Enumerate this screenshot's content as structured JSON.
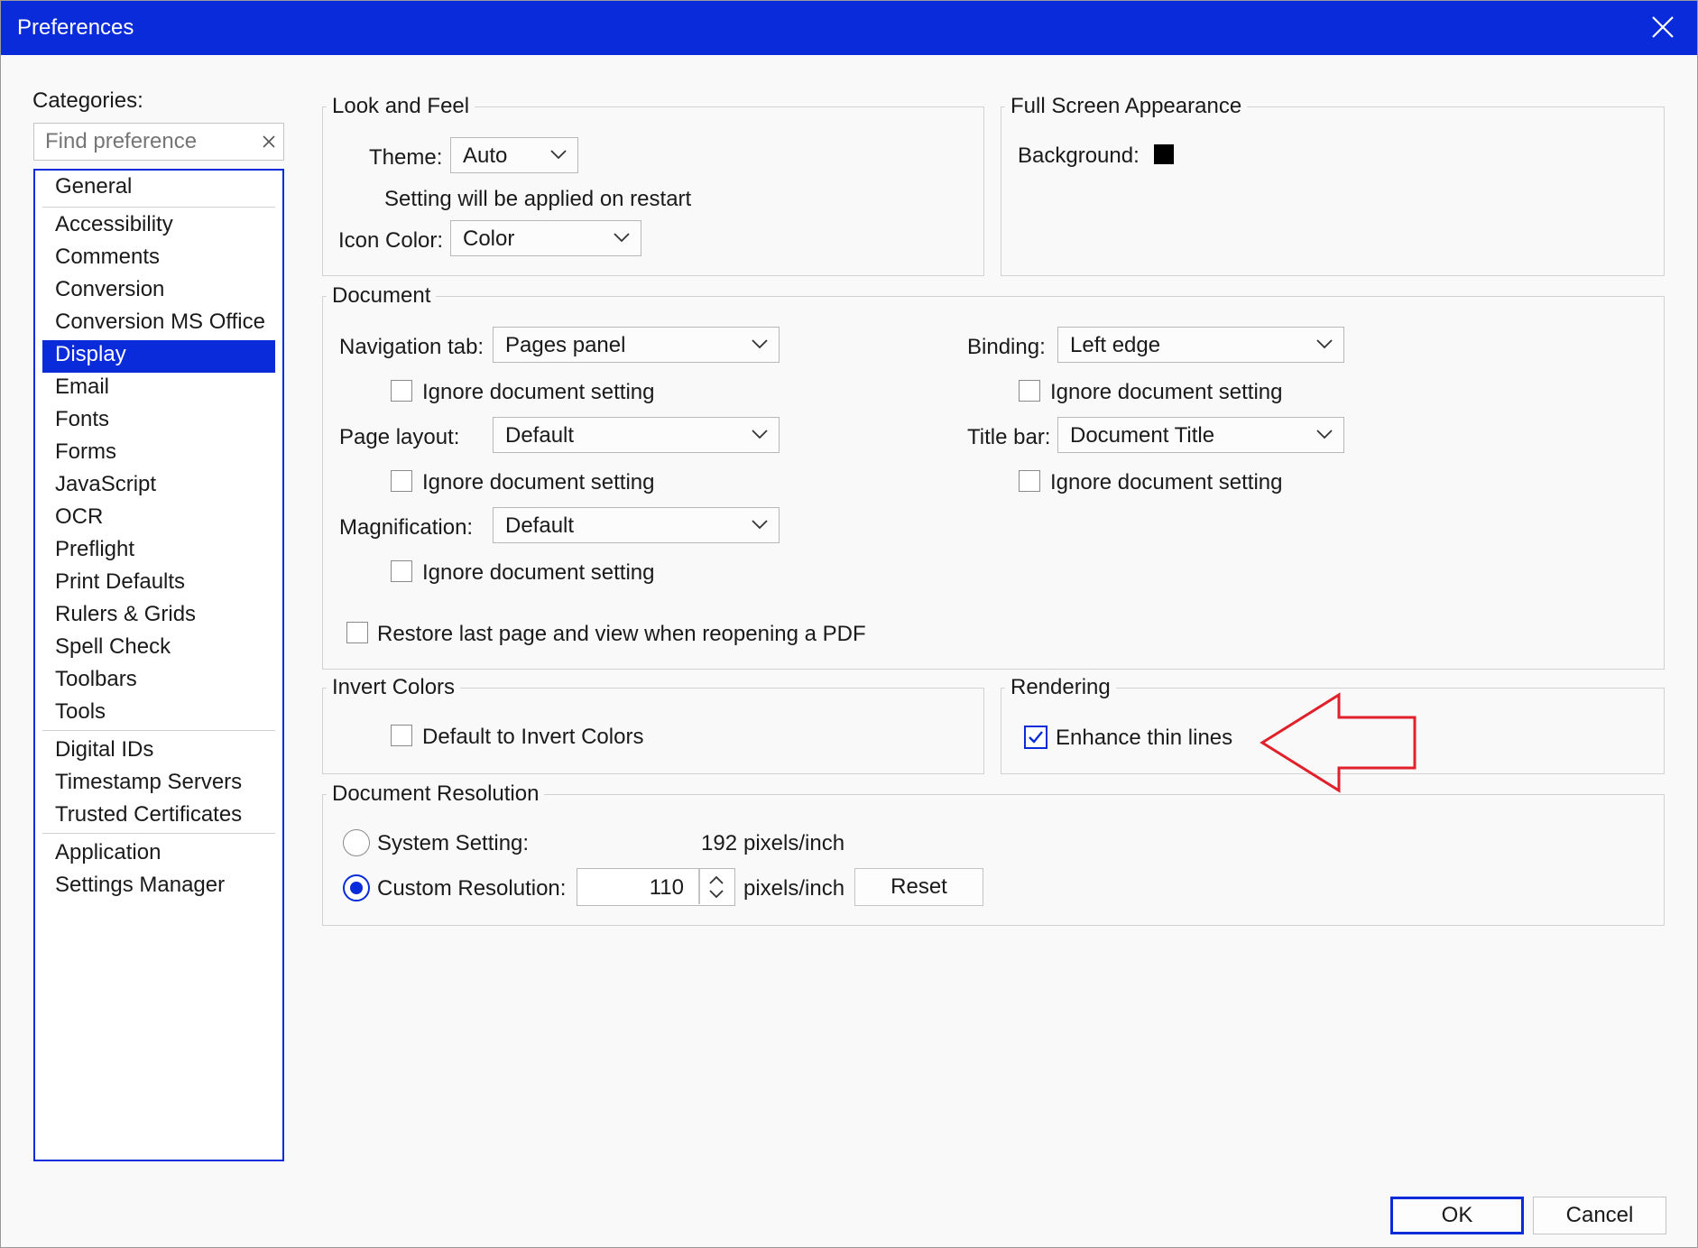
{
  "window": {
    "title": "Preferences",
    "ok_label": "OK",
    "cancel_label": "Cancel"
  },
  "categories": {
    "label": "Categories:",
    "search_placeholder": "Find preference",
    "selected": "Display",
    "items": [
      {
        "label": "General"
      },
      {
        "label": "Accessibility"
      },
      {
        "label": "Comments"
      },
      {
        "label": "Conversion"
      },
      {
        "label": "Conversion MS Office"
      },
      {
        "label": "Display"
      },
      {
        "label": "Email"
      },
      {
        "label": "Fonts"
      },
      {
        "label": "Forms"
      },
      {
        "label": "JavaScript"
      },
      {
        "label": "OCR"
      },
      {
        "label": "Preflight"
      },
      {
        "label": "Print Defaults"
      },
      {
        "label": "Rulers & Grids"
      },
      {
        "label": "Spell Check"
      },
      {
        "label": "Toolbars"
      },
      {
        "label": "Tools"
      },
      {
        "label": "Digital IDs"
      },
      {
        "label": "Timestamp Servers"
      },
      {
        "label": "Trusted Certificates"
      },
      {
        "label": "Application"
      },
      {
        "label": "Settings Manager"
      }
    ]
  },
  "look_and_feel": {
    "legend": "Look and Feel",
    "theme_label": "Theme:",
    "theme_value": "Auto",
    "restart_note": "Setting will be applied on restart",
    "icon_color_label": "Icon Color:",
    "icon_color_value": "Color"
  },
  "full_screen": {
    "legend": "Full Screen Appearance",
    "background_label": "Background:",
    "background_color": "#000000"
  },
  "document": {
    "legend": "Document",
    "navigation_tab_label": "Navigation tab:",
    "navigation_tab_value": "Pages panel",
    "page_layout_label": "Page layout:",
    "page_layout_value": "Default",
    "magnification_label": "Magnification:",
    "magnification_value": "Default",
    "binding_label": "Binding:",
    "binding_value": "Left edge",
    "title_bar_label": "Title bar:",
    "title_bar_value": "Document Title",
    "ignore_label": "Ignore document setting",
    "restore_label": "Restore last page and view when reopening a PDF"
  },
  "invert_colors": {
    "legend": "Invert Colors",
    "default_label": "Default to Invert Colors",
    "checked": false
  },
  "rendering": {
    "legend": "Rendering",
    "enhance_label": "Enhance thin lines",
    "checked": true,
    "annotation_arrow_color": "#e0202a"
  },
  "resolution": {
    "legend": "Document Resolution",
    "system_label": "System Setting:",
    "system_value": "192",
    "unit": "pixels/inch",
    "custom_label": "Custom Resolution:",
    "custom_value": "110",
    "custom_selected": true,
    "reset_label": "Reset"
  },
  "colors": {
    "accent": "#0a2bd9",
    "dialog_bg": "#f9f9f9"
  }
}
